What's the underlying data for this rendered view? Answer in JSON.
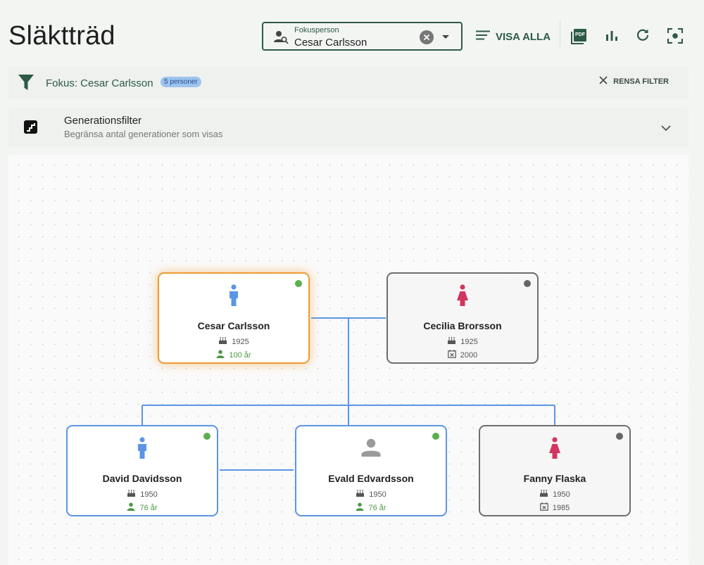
{
  "header": {
    "title": "Släktträd",
    "search": {
      "label": "Fokusperson",
      "value": "Cesar Carlsson"
    },
    "visa_alla_label": "VISA ALLA",
    "pdf_label": "PDF"
  },
  "focus_bar": {
    "text": "Fokus: Cesar Carlsson",
    "badge": "5 personer",
    "clear_label": "RENSA FILTER"
  },
  "generation_filter": {
    "title": "Generationsfilter",
    "subtitle": "Begränsa antal generationer som visas"
  },
  "colors": {
    "primary": "#2d5b45",
    "male": "#5b95e6",
    "female": "#d2365f",
    "focus_border": "#ee9b33",
    "alive_dot": "#5bb04d",
    "deceased_border": "#6e6e6e",
    "connector": "#5b95e6"
  },
  "people": [
    {
      "name": "Cesar Carlsson",
      "gender": "male",
      "birth": "1925",
      "age": "100 år",
      "death": "",
      "status": "alive",
      "focus": true
    },
    {
      "name": "Cecilia Brorsson",
      "gender": "female",
      "birth": "1925",
      "age": "",
      "death": "2000",
      "status": "deceased",
      "focus": false
    },
    {
      "name": "David Davidsson",
      "gender": "male",
      "birth": "1950",
      "age": "76 år",
      "death": "",
      "status": "alive",
      "focus": false
    },
    {
      "name": "Evald Edvardsson",
      "gender": "unknown",
      "birth": "1950",
      "age": "76 år",
      "death": "",
      "status": "alive",
      "focus": false
    },
    {
      "name": "Fanny Flaska",
      "gender": "female",
      "birth": "1950",
      "age": "",
      "death": "1985",
      "status": "deceased",
      "focus": false
    }
  ]
}
